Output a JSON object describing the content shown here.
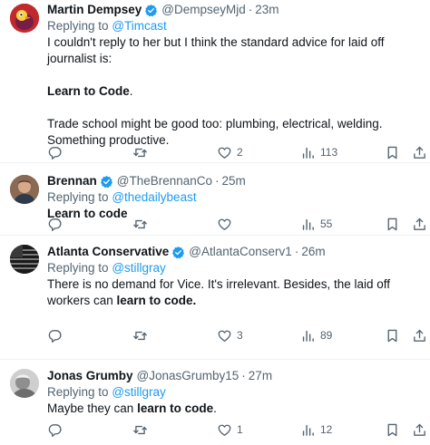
{
  "tweets": [
    {
      "name": "Martin Dempsey",
      "handle": "@DempseyMjd",
      "time": "23m",
      "replying_label": "Replying to",
      "replying_to": "@Timcast",
      "line1": "I couldn't reply to her but I think the standard advice for laid off journalist is:",
      "line2": "Learn to Code",
      "line2_suffix": ".",
      "line3": "Trade school might be good too: plumbing, electrical, welding. Something productive.",
      "likes": "2",
      "views": "113"
    },
    {
      "name": "Brennan",
      "handle": "@TheBrennanCo",
      "time": "25m",
      "replying_label": "Replying to",
      "replying_to": "@thedailybeast",
      "line1": "Learn to code",
      "likes": "",
      "views": "55"
    },
    {
      "name": "Atlanta Conservative",
      "handle": "@AtlantaConserv1",
      "time": "26m",
      "replying_label": "Replying to",
      "replying_to": "@stillgray",
      "line1": "There is no demand for Vice. It's irrelevant. Besides, the laid off workers can ",
      "line1_bold": "learn to code.",
      "likes": "3",
      "views": "89"
    },
    {
      "name": "Jonas Grumby",
      "handle": "@JonasGrumby15",
      "time": "27m",
      "replying_label": "Replying to",
      "replying_to": "@stillgray",
      "line1": "Maybe they can ",
      "line1_bold": "learn to code",
      "line1_suffix": ".",
      "likes": "1",
      "views": "12"
    }
  ],
  "separator": "·",
  "colors": {
    "accent": "#1d9bf0",
    "muted": "#536471",
    "text": "#0f1419",
    "divider": "#eff3f4"
  },
  "icons": [
    "verified-badge-icon",
    "reply-icon",
    "retweet-icon",
    "like-icon",
    "views-icon",
    "bookmark-icon",
    "share-icon"
  ]
}
